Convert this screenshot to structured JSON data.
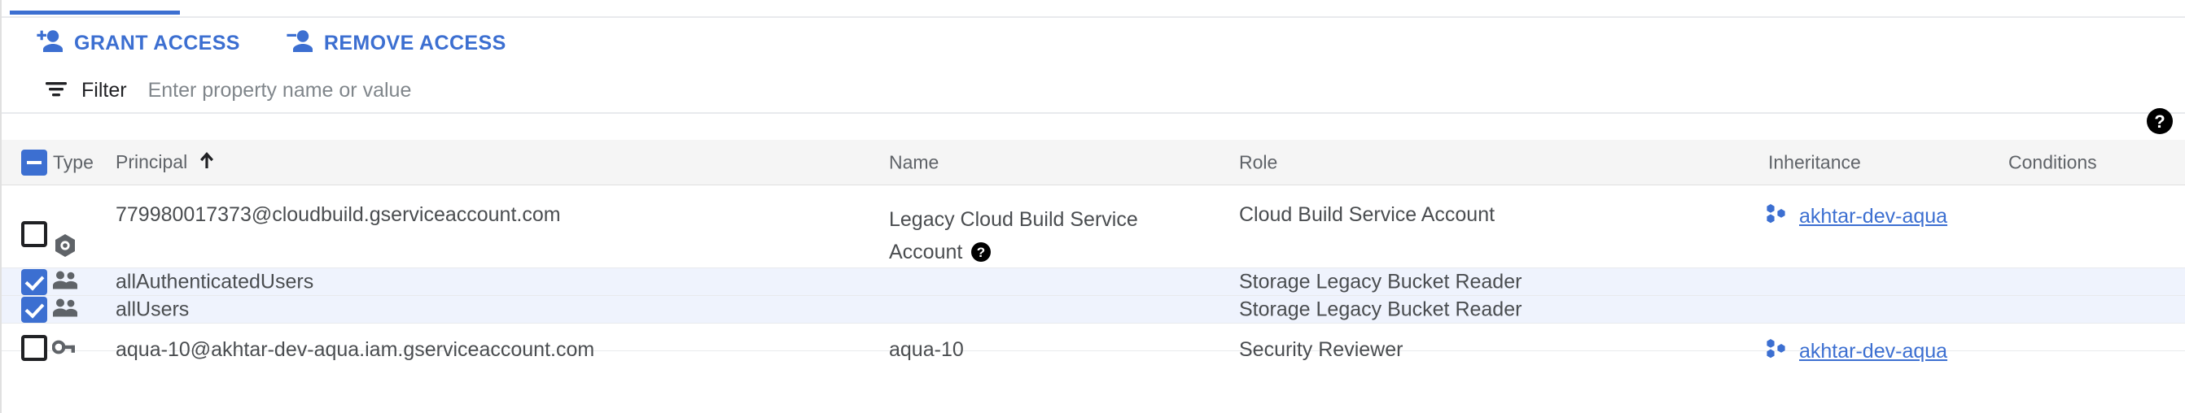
{
  "theme": {
    "accent": "#3c6fd1",
    "selected_row_bg": "#eff3fd",
    "header_bg": "#f5f5f5",
    "text": "#202124",
    "muted_text": "#5f6368"
  },
  "toolbar": {
    "grant_access_label": "GRANT ACCESS",
    "grant_access_icon": "person-add-icon",
    "remove_access_label": "REMOVE ACCESS",
    "remove_access_icon": "person-remove-icon"
  },
  "filter": {
    "icon": "filter-list-icon",
    "label": "Filter",
    "value": "",
    "placeholder": "Enter property name or value"
  },
  "help": {
    "icon": "help-circle-icon"
  },
  "table": {
    "select_all_state": "indeterminate",
    "sort_column": "Principal",
    "sort_direction": "ascending",
    "sort_icon": "arrow-up-icon",
    "columns": [
      {
        "key": "type",
        "label": "Type"
      },
      {
        "key": "principal",
        "label": "Principal"
      },
      {
        "key": "name",
        "label": "Name"
      },
      {
        "key": "role",
        "label": "Role"
      },
      {
        "key": "inheritance",
        "label": "Inheritance"
      },
      {
        "key": "conditions",
        "label": "Conditions"
      }
    ],
    "rows": [
      {
        "selected": false,
        "type_icon": "service-account-icon",
        "principal": "779980017373@cloudbuild.gserviceaccount.com",
        "name": "Legacy Cloud Build Service Account",
        "name_help_icon": "help-circle-icon",
        "role": "Cloud Build Service Account",
        "inheritance": "akhtar-dev-aqua",
        "inheritance_icon": "project-icon",
        "conditions": ""
      },
      {
        "selected": true,
        "type_icon": "group-icon",
        "principal": "allAuthenticatedUsers",
        "name": "",
        "role": "Storage Legacy Bucket Reader",
        "inheritance": "",
        "conditions": ""
      },
      {
        "selected": true,
        "type_icon": "group-icon",
        "principal": "allUsers",
        "name": "",
        "role": "Storage Legacy Bucket Reader",
        "inheritance": "",
        "conditions": ""
      },
      {
        "selected": false,
        "type_icon": "key-icon",
        "principal": "aqua-10@akhtar-dev-aqua.iam.gserviceaccount.com",
        "name": "aqua-10",
        "role": "Security Reviewer",
        "inheritance": "akhtar-dev-aqua",
        "inheritance_icon": "project-icon",
        "conditions": ""
      }
    ]
  }
}
